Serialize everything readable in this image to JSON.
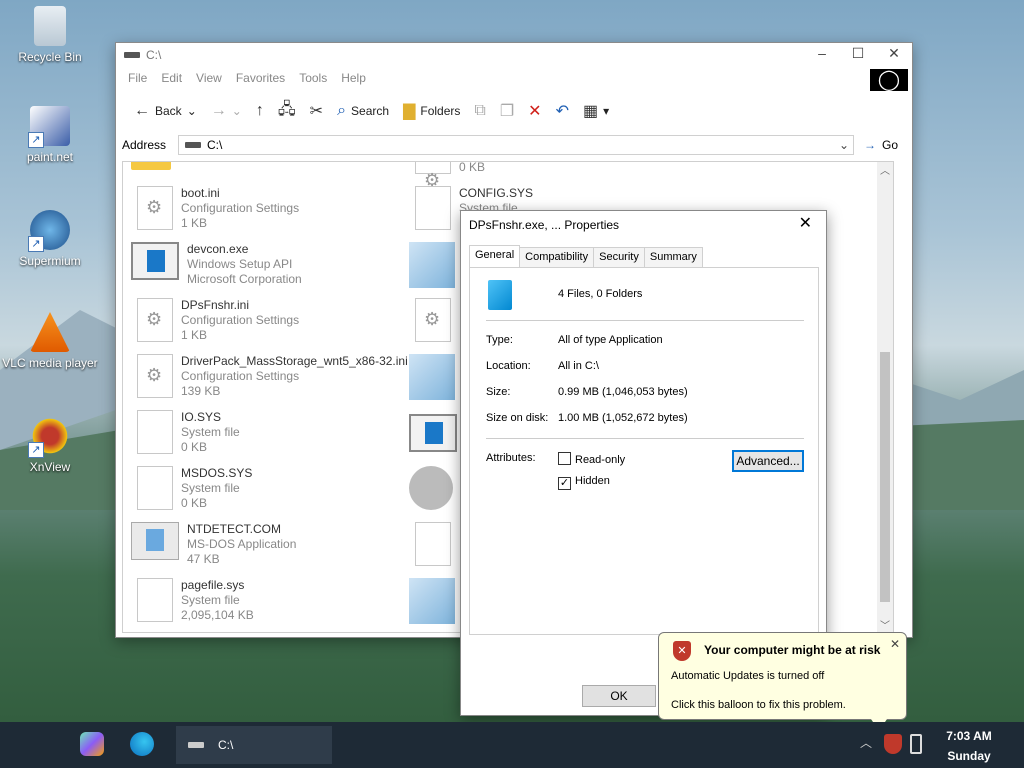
{
  "desktop": {
    "icons": [
      {
        "label": "Recycle Bin"
      },
      {
        "label": "paint.net"
      },
      {
        "label": "Supermium"
      },
      {
        "label": "VLC media player"
      },
      {
        "label": "XnView"
      }
    ]
  },
  "explorer": {
    "title": "C:\\",
    "menu": [
      "File",
      "Edit",
      "View",
      "Favorites",
      "Tools",
      "Help"
    ],
    "toolbar": {
      "back": "Back",
      "search": "Search",
      "folders": "Folders"
    },
    "address_label": "Address",
    "address_value": "C:\\",
    "go_label": "Go",
    "files_left": [
      {
        "name": "",
        "line2": "",
        "line3": ""
      },
      {
        "name": "boot.ini",
        "line2": "Configuration Settings",
        "line3": "1 KB"
      },
      {
        "name": "devcon.exe",
        "line2": "Windows Setup API",
        "line3": "Microsoft Corporation"
      },
      {
        "name": "DPsFnshr.ini",
        "line2": "Configuration Settings",
        "line3": "1 KB"
      },
      {
        "name": "DriverPack_MassStorage_wnt5_x86-32.ini",
        "line2": "Configuration Settings",
        "line3": "139 KB"
      },
      {
        "name": "IO.SYS",
        "line2": "System file",
        "line3": "0 KB"
      },
      {
        "name": "MSDOS.SYS",
        "line2": "System file",
        "line3": "0 KB"
      },
      {
        "name": "NTDETECT.COM",
        "line2": "MS-DOS Application",
        "line3": "47 KB"
      },
      {
        "name": "pagefile.sys",
        "line2": "System file",
        "line3": "2,095,104 KB"
      }
    ],
    "files_right": [
      {
        "name": "",
        "line2": "0 KB"
      },
      {
        "name": "CONFIG.SYS",
        "line2": "System file"
      }
    ]
  },
  "properties": {
    "title": "DPsFnshr.exe, ... Properties",
    "tabs": [
      "General",
      "Compatibility",
      "Security",
      "Summary"
    ],
    "summary": "4 Files, 0 Folders",
    "type_label": "Type:",
    "type_value": "All of type Application",
    "location_label": "Location:",
    "location_value": "All in C:\\",
    "size_label": "Size:",
    "size_value": "0.99 MB (1,046,053 bytes)",
    "sod_label": "Size on disk:",
    "sod_value": "1.00 MB (1,052,672 bytes)",
    "attributes_label": "Attributes:",
    "readonly_label": "Read-only",
    "readonly_checked": false,
    "hidden_label": "Hidden",
    "hidden_checked": true,
    "advanced_label": "Advanced...",
    "ok_label": "OK"
  },
  "balloon": {
    "title": "Your computer might be at risk",
    "line1": "Automatic Updates is turned off",
    "line2": "Click this balloon to fix this problem."
  },
  "taskbar": {
    "task_label": "C:\\",
    "time": "7:03 AM",
    "day": "Sunday"
  }
}
